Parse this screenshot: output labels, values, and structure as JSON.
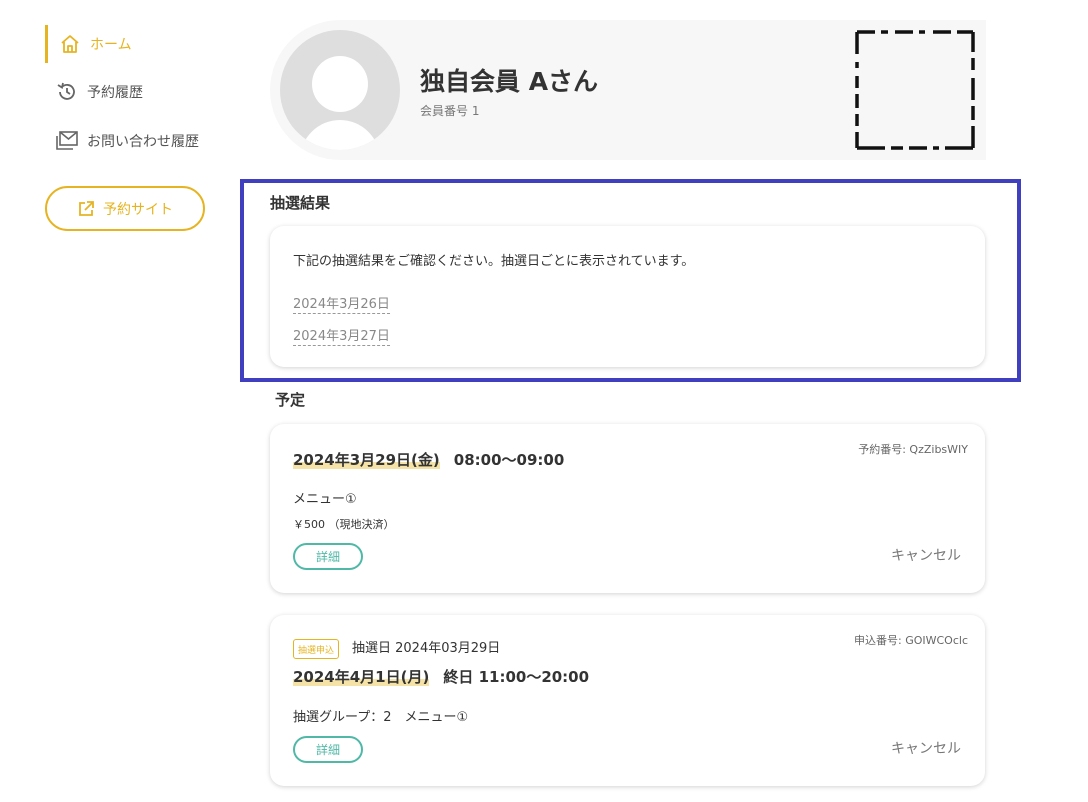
{
  "sidebar": {
    "items": [
      {
        "label": "ホーム",
        "icon": "home-icon"
      },
      {
        "label": "予約履歴",
        "icon": "history-icon"
      },
      {
        "label": "お問い合わせ履歴",
        "icon": "mail-icon"
      }
    ],
    "site_button": {
      "label": "予約サイト",
      "icon": "external-link-icon"
    }
  },
  "profile": {
    "name": "独自会員 Aさん",
    "member_number": "会員番号 1"
  },
  "lottery": {
    "title": "抽選結果",
    "description": "下記の抽選結果をご確認ください。抽選日ごとに表示されています。",
    "dates": [
      "2024年3月26日",
      "2024年3月27日"
    ]
  },
  "schedule": {
    "title": "予定",
    "reservations": [
      {
        "number": "予約番号: QzZibsWIY",
        "date": "2024年3月29日(金)",
        "time": "08:00〜09:00",
        "menu": "メニュー①",
        "price": "￥500 （現地決済）",
        "detail_label": "詳細",
        "cancel_label": "キャンセル"
      },
      {
        "badge": "抽選申込",
        "draw_date": "抽選日 2024年03月29日",
        "number": "申込番号: GOIWCOclc",
        "date": "2024年4月1日(月)",
        "time": "終日 11:00〜20:00",
        "menu": "抽選グループ：2　メニュー①",
        "detail_label": "詳細",
        "cancel_label": "キャンセル"
      }
    ]
  },
  "colors": {
    "accent": "#e6b422",
    "teal": "#4fb8a6",
    "highlight_border": "#3f3fbf"
  }
}
